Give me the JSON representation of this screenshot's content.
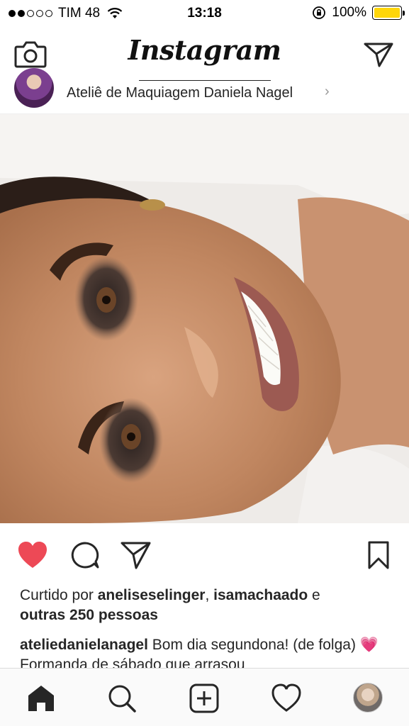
{
  "status_bar": {
    "carrier": "TIM 48",
    "time": "13:18",
    "battery_percent": "100%",
    "battery_level": 1.0,
    "signal_bars": 2,
    "signal_total": 5
  },
  "nav": {
    "title": "Instagram",
    "left_icon": "camera-icon",
    "right_icon": "direct-message-icon"
  },
  "post": {
    "username": "Ateliê de Maquiagem Daniela Nagel",
    "chevron": "›",
    "liked": true,
    "likes_prefix": "Curtido por ",
    "liker1": "aneliseselinger",
    "liker_sep": ", ",
    "liker2": "isamachaado",
    "likes_and": " e",
    "likes_others": "outras 250 pessoas",
    "caption_user": "ateliedanielanagel",
    "caption_text": " Bom dia segundona! (de folga) 💗 Formanda de sábado que arrasou"
  },
  "tab_bar": {
    "items": [
      "home-icon",
      "search-icon",
      "new-post-icon",
      "activity-heart-icon",
      "profile-avatar"
    ],
    "active": "home-icon"
  },
  "colors": {
    "like_red": "#ed4956",
    "battery_yellow": "#ffd60a",
    "text": "#262626"
  }
}
